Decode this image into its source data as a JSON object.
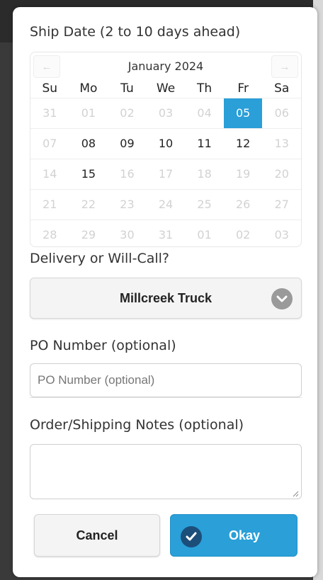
{
  "dialog": {
    "ship_date_label": "Ship Date (2 to 10 days ahead)",
    "calendar": {
      "month_label": "January 2024",
      "prev_label": "←",
      "next_label": "→",
      "weekdays": [
        "Su",
        "Mo",
        "Tu",
        "We",
        "Th",
        "Fr",
        "Sa"
      ],
      "weeks": [
        [
          "31",
          "01",
          "02",
          "03",
          "04",
          "05",
          "06"
        ],
        [
          "07",
          "08",
          "09",
          "10",
          "11",
          "12",
          "13"
        ],
        [
          "14",
          "15",
          "16",
          "17",
          "18",
          "19",
          "20"
        ],
        [
          "21",
          "22",
          "23",
          "24",
          "25",
          "26",
          "27"
        ],
        [
          "28",
          "29",
          "30",
          "31",
          "01",
          "02",
          "03"
        ]
      ],
      "selected": "05",
      "available": [
        "08",
        "09",
        "10",
        "11",
        "12",
        "15"
      ]
    },
    "delivery_label": "Delivery or Will-Call?",
    "delivery_value": "Millcreek Truck",
    "po_label": "PO Number (optional)",
    "po_placeholder": "PO Number (optional)",
    "po_value": "",
    "notes_label": "Order/Shipping Notes (optional)",
    "notes_value": "",
    "cancel_label": "Cancel",
    "okay_label": "Okay"
  },
  "colors": {
    "accent": "#2a9fd8",
    "check_bg": "#1c4e7a",
    "disabled_day": "#d2d2d2"
  }
}
